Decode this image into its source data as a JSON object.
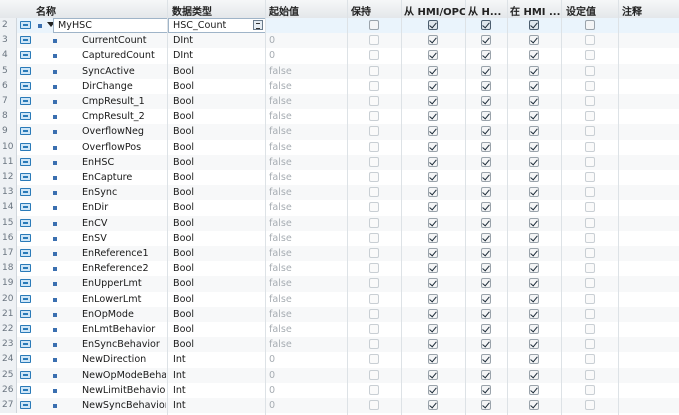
{
  "headers": {
    "name": "名称",
    "datatype": "数据类型",
    "start": "起始值",
    "retain": "保持",
    "hmi_opc": "从 HMI/OPC...",
    "hmi_h": "从 H...",
    "in_hmi": "在 HMI ...",
    "setpoint": "设定值",
    "comment": "注释"
  },
  "rows": [
    {
      "num": "2",
      "name": "MyHSC",
      "type": "HSC_Count",
      "start": "",
      "retain": false,
      "hmi1": true,
      "hmi2": true,
      "hmi3": true,
      "set": false,
      "parent": true
    },
    {
      "num": "3",
      "name": "CurrentCount",
      "type": "DInt",
      "start": "0",
      "retain": false,
      "hmi1": true,
      "hmi2": true,
      "hmi3": true,
      "set": false
    },
    {
      "num": "4",
      "name": "CapturedCount",
      "type": "DInt",
      "start": "0",
      "retain": false,
      "hmi1": true,
      "hmi2": true,
      "hmi3": true,
      "set": false
    },
    {
      "num": "5",
      "name": "SyncActive",
      "type": "Bool",
      "start": "false",
      "retain": false,
      "hmi1": true,
      "hmi2": true,
      "hmi3": true,
      "set": false
    },
    {
      "num": "6",
      "name": "DirChange",
      "type": "Bool",
      "start": "false",
      "retain": false,
      "hmi1": true,
      "hmi2": true,
      "hmi3": true,
      "set": false
    },
    {
      "num": "7",
      "name": "CmpResult_1",
      "type": "Bool",
      "start": "false",
      "retain": false,
      "hmi1": true,
      "hmi2": true,
      "hmi3": true,
      "set": false
    },
    {
      "num": "8",
      "name": "CmpResult_2",
      "type": "Bool",
      "start": "false",
      "retain": false,
      "hmi1": true,
      "hmi2": true,
      "hmi3": true,
      "set": false
    },
    {
      "num": "9",
      "name": "OverflowNeg",
      "type": "Bool",
      "start": "false",
      "retain": false,
      "hmi1": true,
      "hmi2": true,
      "hmi3": true,
      "set": false
    },
    {
      "num": "10",
      "name": "OverflowPos",
      "type": "Bool",
      "start": "false",
      "retain": false,
      "hmi1": true,
      "hmi2": true,
      "hmi3": true,
      "set": false
    },
    {
      "num": "11",
      "name": "EnHSC",
      "type": "Bool",
      "start": "false",
      "retain": false,
      "hmi1": true,
      "hmi2": true,
      "hmi3": true,
      "set": false
    },
    {
      "num": "12",
      "name": "EnCapture",
      "type": "Bool",
      "start": "false",
      "retain": false,
      "hmi1": true,
      "hmi2": true,
      "hmi3": true,
      "set": false
    },
    {
      "num": "13",
      "name": "EnSync",
      "type": "Bool",
      "start": "false",
      "retain": false,
      "hmi1": true,
      "hmi2": true,
      "hmi3": true,
      "set": false
    },
    {
      "num": "14",
      "name": "EnDir",
      "type": "Bool",
      "start": "false",
      "retain": false,
      "hmi1": true,
      "hmi2": true,
      "hmi3": true,
      "set": false
    },
    {
      "num": "15",
      "name": "EnCV",
      "type": "Bool",
      "start": "false",
      "retain": false,
      "hmi1": true,
      "hmi2": true,
      "hmi3": true,
      "set": false
    },
    {
      "num": "16",
      "name": "EnSV",
      "type": "Bool",
      "start": "false",
      "retain": false,
      "hmi1": true,
      "hmi2": true,
      "hmi3": true,
      "set": false
    },
    {
      "num": "17",
      "name": "EnReference1",
      "type": "Bool",
      "start": "false",
      "retain": false,
      "hmi1": true,
      "hmi2": true,
      "hmi3": true,
      "set": false
    },
    {
      "num": "18",
      "name": "EnReference2",
      "type": "Bool",
      "start": "false",
      "retain": false,
      "hmi1": true,
      "hmi2": true,
      "hmi3": true,
      "set": false
    },
    {
      "num": "19",
      "name": "EnUpperLmt",
      "type": "Bool",
      "start": "false",
      "retain": false,
      "hmi1": true,
      "hmi2": true,
      "hmi3": true,
      "set": false
    },
    {
      "num": "20",
      "name": "EnLowerLmt",
      "type": "Bool",
      "start": "false",
      "retain": false,
      "hmi1": true,
      "hmi2": true,
      "hmi3": true,
      "set": false
    },
    {
      "num": "21",
      "name": "EnOpMode",
      "type": "Bool",
      "start": "false",
      "retain": false,
      "hmi1": true,
      "hmi2": true,
      "hmi3": true,
      "set": false
    },
    {
      "num": "22",
      "name": "EnLmtBehavior",
      "type": "Bool",
      "start": "false",
      "retain": false,
      "hmi1": true,
      "hmi2": true,
      "hmi3": true,
      "set": false
    },
    {
      "num": "23",
      "name": "EnSyncBehavior",
      "type": "Bool",
      "start": "false",
      "retain": false,
      "hmi1": true,
      "hmi2": true,
      "hmi3": true,
      "set": false
    },
    {
      "num": "24",
      "name": "NewDirection",
      "type": "Int",
      "start": "0",
      "retain": false,
      "hmi1": true,
      "hmi2": true,
      "hmi3": true,
      "set": false
    },
    {
      "num": "25",
      "name": "NewOpModeBeha...",
      "type": "Int",
      "start": "0",
      "retain": false,
      "hmi1": true,
      "hmi2": true,
      "hmi3": true,
      "set": false
    },
    {
      "num": "26",
      "name": "NewLimitBehavior",
      "type": "Int",
      "start": "0",
      "retain": false,
      "hmi1": true,
      "hmi2": true,
      "hmi3": true,
      "set": false
    },
    {
      "num": "27",
      "name": "NewSyncBehavior",
      "type": "Int",
      "start": "0",
      "retain": false,
      "hmi1": true,
      "hmi2": true,
      "hmi3": true,
      "set": false
    }
  ]
}
